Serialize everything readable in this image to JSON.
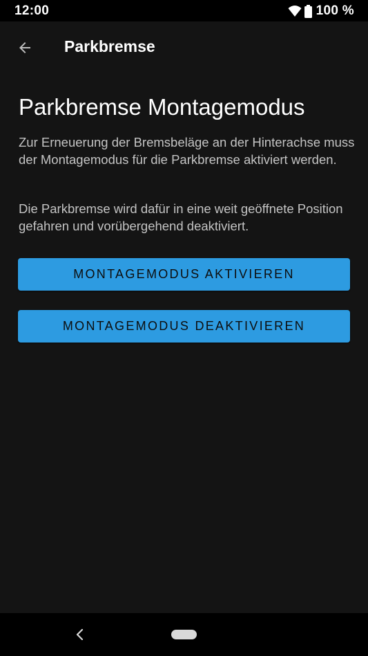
{
  "status_bar": {
    "time": "12:00",
    "battery": "100 %",
    "wifi_icon": "wifi-icon",
    "battery_icon": "battery-icon"
  },
  "app_bar": {
    "title": "Parkbremse",
    "back_icon": "arrow-back-icon"
  },
  "main": {
    "heading": "Parkbremse Montagemodus",
    "description_1": "Zur Erneuerung der Bremsbeläge an der Hinterachse muss der Montagemodus für die Parkbremse aktiviert werden.",
    "description_2": "Die Parkbremse wird dafür in eine weit geöffnete Position gefahren und vorübergehend deaktiviert.",
    "activate_label": "MONTAGEMODUS AKTIVIEREN",
    "deactivate_label": "MONTAGEMODUS DEAKTIVIEREN"
  },
  "nav_bar": {
    "back_icon": "nav-back-icon",
    "home_icon": "nav-home-pill"
  },
  "colors": {
    "background": "#141414",
    "button": "#2d9be1",
    "text_primary": "#ffffff",
    "text_secondary": "#c4c4c4",
    "system_bars": "#000000"
  }
}
